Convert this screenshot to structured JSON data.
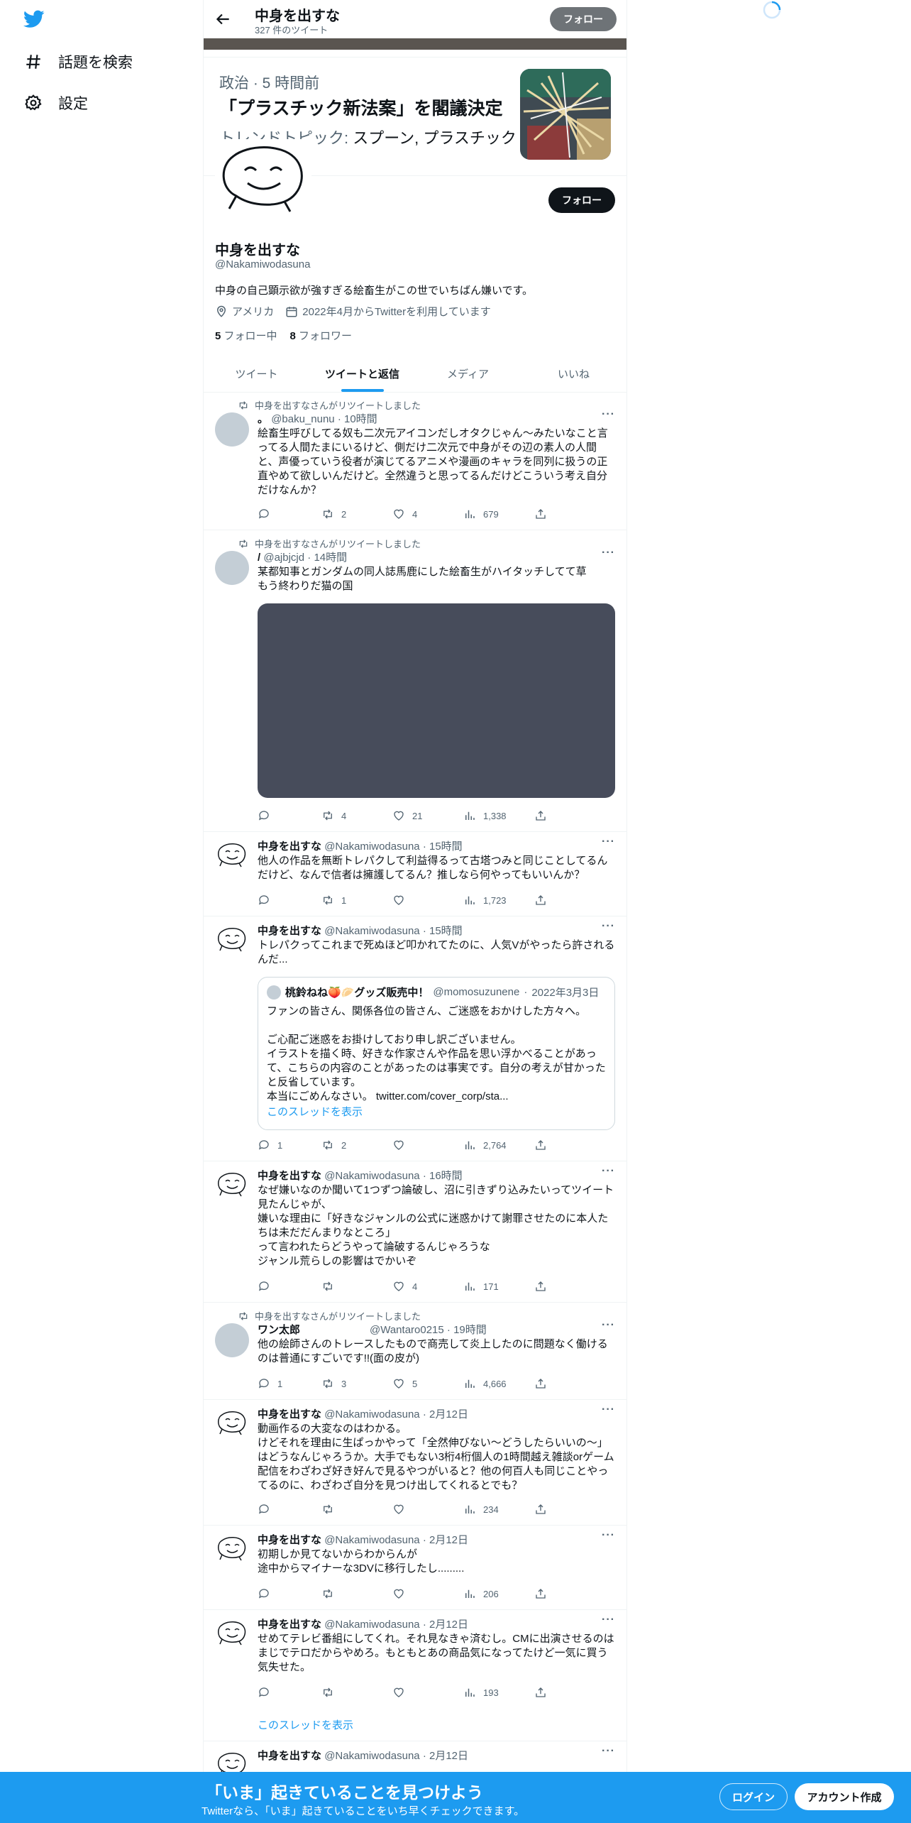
{
  "sidebar": {
    "items": [
      {
        "label": "話題を検索",
        "icon": "hash-icon"
      },
      {
        "label": "設定",
        "icon": "gear-icon"
      }
    ]
  },
  "header": {
    "title": "中身を出すな",
    "subtitle": "327 件のツイート",
    "follow_label": "フォロー"
  },
  "trend": {
    "meta": "政治 · 5 時間前",
    "title": "「プラスチック新法案」を閣議決定",
    "topic_prefix": "トレンドトピック: ",
    "topic_value": "スプーン, プラスチック"
  },
  "profile": {
    "name": "中身を出すな",
    "handle": "@Nakamiwodasuna",
    "bio": "中身の自己顕示欲が強すぎる絵畜生がこの世でいちばん嫌いです。",
    "location": "アメリカ",
    "joined": "2022年4月からTwitterを利用しています",
    "following_count": "5",
    "following_label": "フォロー中",
    "followers_count": "8",
    "followers_label": "フォロワー",
    "follow_label": "フォロー"
  },
  "tabs": [
    "ツイート",
    "ツイートと返信",
    "メディア",
    "いいね"
  ],
  "tweets": [
    {
      "retweet": "中身を出すなさんがリツイートしました",
      "name": "。",
      "handle": "@baku_nunu",
      "time": "10時間",
      "text": "絵畜生呼びしてる奴も二次元アイコンだしオタクじゃん〜みたいなこと言ってる人間たまにいるけど、側だけ二次元で中身がその辺の素人の人間と、声優っていう役者が演じてるアニメや漫画のキャラを同列に扱うの正直やめて欲しいんだけど。全然違うと思ってるんだけどこういう考え自分だけなんか？",
      "replies": "",
      "retweets": "2",
      "likes": "4",
      "views": "679"
    },
    {
      "retweet": "中身を出すなさんがリツイートしました",
      "name": "/",
      "handle": "@ajbjcjd",
      "time": "14時間",
      "text": "某都知事とガンダムの同人誌馬鹿にした絵畜生がハイタッチしてて草\nもう終わりだ猫の国",
      "replies": "",
      "retweets": "4",
      "likes": "21",
      "views": "1,338"
    },
    {
      "name": "中身を出すな",
      "handle": "@Nakamiwodasuna",
      "time": "15時間",
      "text": "他人の作品を無断トレパクして利益得るって古塔つみと同じことしてるんだけど、なんで信者は擁護してるん？推しなら何やってもいいんか？",
      "replies": "",
      "retweets": "1",
      "likes": "",
      "views": "1,723"
    },
    {
      "name": "中身を出すな",
      "handle": "@Nakamiwodasuna",
      "time": "15時間",
      "text": "トレパクってこれまで死ぬほど叩かれてたのに、人気Vがやったら許されるんだ...",
      "quote": {
        "name": "桃鈴ねね🍑🥟グッズ販売中！",
        "handle": "@momosuzunene",
        "time": "2022年3月3日",
        "text": "ファンの皆さん、関係各位の皆さん、ご迷惑をおかけした方々へ。\n\nご心配ご迷惑をお掛けしており申し訳ございません。\nイラストを描く時、好きな作家さんや作品を思い浮かべることがあって、こちらの内容のことがあったのは事実です。自分の考えが甘かったと反省しています。\n本当にごめんなさい。 twitter.com/cover_corp/sta...",
        "thread_link": "このスレッドを表示"
      },
      "replies": "1",
      "retweets": "2",
      "likes": "",
      "views": "2,764"
    },
    {
      "name": "中身を出すな",
      "handle": "@Nakamiwodasuna",
      "time": "16時間",
      "text": "なぜ嫌いなのか聞いて1つずつ論破し、沼に引きずり込みたいってツイート見たんじゃが、\n嫌いな理由に「好きなジャンルの公式に迷惑かけて謝罪させたのに本人たちは未だだんまりなところ」\nって言われたらどうやって論破するんじゃろうな\nジャンル荒らしの影響はでかいぞ",
      "replies": "",
      "retweets": "",
      "likes": "4",
      "views": "171"
    },
    {
      "retweet": "中身を出すなさんがリツイートしました",
      "name": "ワン太郎",
      "handle": "@Wantaro0215",
      "time": "19時間",
      "text": "他の絵師さんのトレースしたもので商売して炎上したのに問題なく働けるのは普通にすごいです!!(面の皮が)",
      "replies": "1",
      "retweets": "3",
      "likes": "5",
      "views": "4,666"
    },
    {
      "name": "中身を出すな",
      "handle": "@Nakamiwodasuna",
      "time": "2月12日",
      "text": "動画作るの大変なのはわかる。\nけどそれを理由に生ぱっかやって「全然伸びない〜どうしたらいいの〜」はどうなんじゃろうか。大手でもない3桁4桁個人の1時間越え雑談orゲーム配信をわざわざ好き好んで見るやつがいると？他の何百人も同じことやってるのに、わざわざ自分を見つけ出してくれるとでも？",
      "replies": "",
      "retweets": "",
      "likes": "",
      "views": "234"
    },
    {
      "name": "中身を出すな",
      "handle": "@Nakamiwodasuna",
      "time": "2月12日",
      "text": "初期しか見てないからわからんが\n途中からマイナーな3DVに移行したし.........",
      "replies": "",
      "retweets": "",
      "likes": "",
      "views": "206"
    },
    {
      "name": "中身を出すな",
      "handle": "@Nakamiwodasuna",
      "time": "2月12日",
      "text": "せめてテレビ番組にしてくれ。それ見なきゃ済むし。CMに出演させるのはまじでテロだからやめろ。もともとあの商品気になってたけど一気に買う気失せた。",
      "replies": "",
      "retweets": "",
      "likes": "",
      "views": "193",
      "thread_link": "このスレッドを表示"
    },
    {
      "name": "中身を出すな",
      "handle": "@Nakamiwodasuna",
      "time": "2月12日"
    }
  ],
  "bottom_bar": {
    "title": "「いま」起きていることを見つけよう",
    "subtitle": "Twitterなら、「いま」起きていることをいち早くチェックできます。",
    "login_label": "ログイン",
    "signup_label": "アカウント作成"
  },
  "colors": {
    "accent": "#1d9bf0",
    "text": "#0f1419",
    "muted": "#536471",
    "dark_button": "#0f1419"
  }
}
